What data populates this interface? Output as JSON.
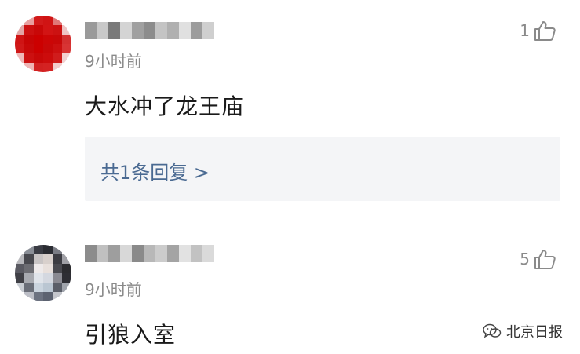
{
  "comments": [
    {
      "time": "9小时前",
      "like_count": "1",
      "text": "大水冲了龙王庙",
      "reply_link": "共1条回复 >",
      "avatar_colors": [
        "#ffffff",
        "#e8a0a0",
        "#d21a1a",
        "#d01414",
        "#e07878",
        "#ffffff",
        "#e2a6a6",
        "#cc1010",
        "#c80808",
        "#d21414",
        "#cc1212",
        "#efc4c4",
        "#cf1414",
        "#c70505",
        "#cc0000",
        "#cc0606",
        "#c80808",
        "#d43030",
        "#d01818",
        "#c80808",
        "#cc0000",
        "#c80808",
        "#cc1010",
        "#d83434",
        "#eeb8b8",
        "#cc1010",
        "#c80808",
        "#cc0c0c",
        "#d01c1c",
        "#f2d0d0",
        "#ffffff",
        "#eeb4b4",
        "#d22020",
        "#d42222",
        "#f2cccc",
        "#ffffff"
      ],
      "name_colors": [
        "#9a9a9a",
        "#c8c8c8",
        "#7a7a7a",
        "#d4d4d4",
        "#a0a0a0",
        "#8c8c8c",
        "#c4c4c4",
        "#b0b0b0",
        "#e0e0e0",
        "#9c9c9c",
        "#cfcfcf"
      ]
    },
    {
      "time": "9小时前",
      "like_count": "5",
      "text": "引狼入室",
      "avatar_colors": [
        "#ffffff",
        "#8a8e96",
        "#3a3c44",
        "#2a2c32",
        "#7a7c84",
        "#ffffff",
        "#b8b8bc",
        "#48484e",
        "#c8c4c4",
        "#d8d0cc",
        "#3c3c42",
        "#a0a0a6",
        "#5a5a62",
        "#6c6c72",
        "#eeeaea",
        "#e8e0dc",
        "#4a4a50",
        "#2c2c30",
        "#404046",
        "#a8aab0",
        "#e0e4ea",
        "#d4d8e0",
        "#8a8a92",
        "#2e2e34",
        "#c8ccd2",
        "#6a6e78",
        "#cad4de",
        "#bac6d2",
        "#5a5e68",
        "#a0a4ac",
        "#ffffff",
        "#bcbec6",
        "#6c7280",
        "#5c6270",
        "#c4c6cc",
        "#ffffff"
      ],
      "name_colors": [
        "#8c8c8c",
        "#c0c0c0",
        "#9e9e9e",
        "#d8d8d8",
        "#8a8a8a",
        "#b8b8b8",
        "#cccccc",
        "#a4a4a4",
        "#e2e2e2",
        "#c2c2c2",
        "#dadada"
      ]
    }
  ],
  "watermark": {
    "label": "北京日报",
    "icon": "wechat-icon"
  }
}
